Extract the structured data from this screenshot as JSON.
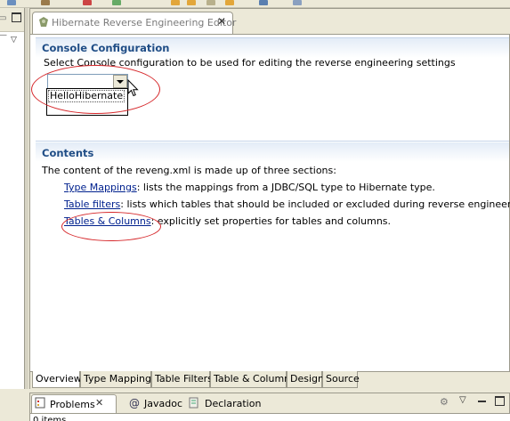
{
  "editor": {
    "title": "Hibernate Reverse Engineering Editor",
    "close_glyph": "✕"
  },
  "console": {
    "title": "Console Configuration",
    "description": "Select Console configuration to be used for editing the reverse engineering settings",
    "dropdown_options": [
      "HelloHibernate"
    ]
  },
  "contents": {
    "title": "Contents",
    "intro": "The content of the reveng.xml is made up of three sections:",
    "items": [
      {
        "link": "Type Mappings",
        "text": ": lists the mappings from a JDBC/SQL type to Hibernate type."
      },
      {
        "link": "Table filters",
        "text": ": lists which tables that should be included or excluded during reverse engineering."
      },
      {
        "link": "Tables & Columns",
        "text": ": explicitly set properties for tables and columns."
      }
    ]
  },
  "bottom_tabs": [
    "Overview",
    "Type Mappings",
    "Table Filters",
    "Table & Columns",
    "Design",
    "Source"
  ],
  "views": {
    "tabs": [
      "Problems",
      "Javadoc",
      "Declaration"
    ],
    "close_glyph": "✕",
    "status_partial": "0 items"
  },
  "colors": {
    "section_title": "#1f4d86",
    "link": "#00218e",
    "annotation": "#d6282b"
  }
}
